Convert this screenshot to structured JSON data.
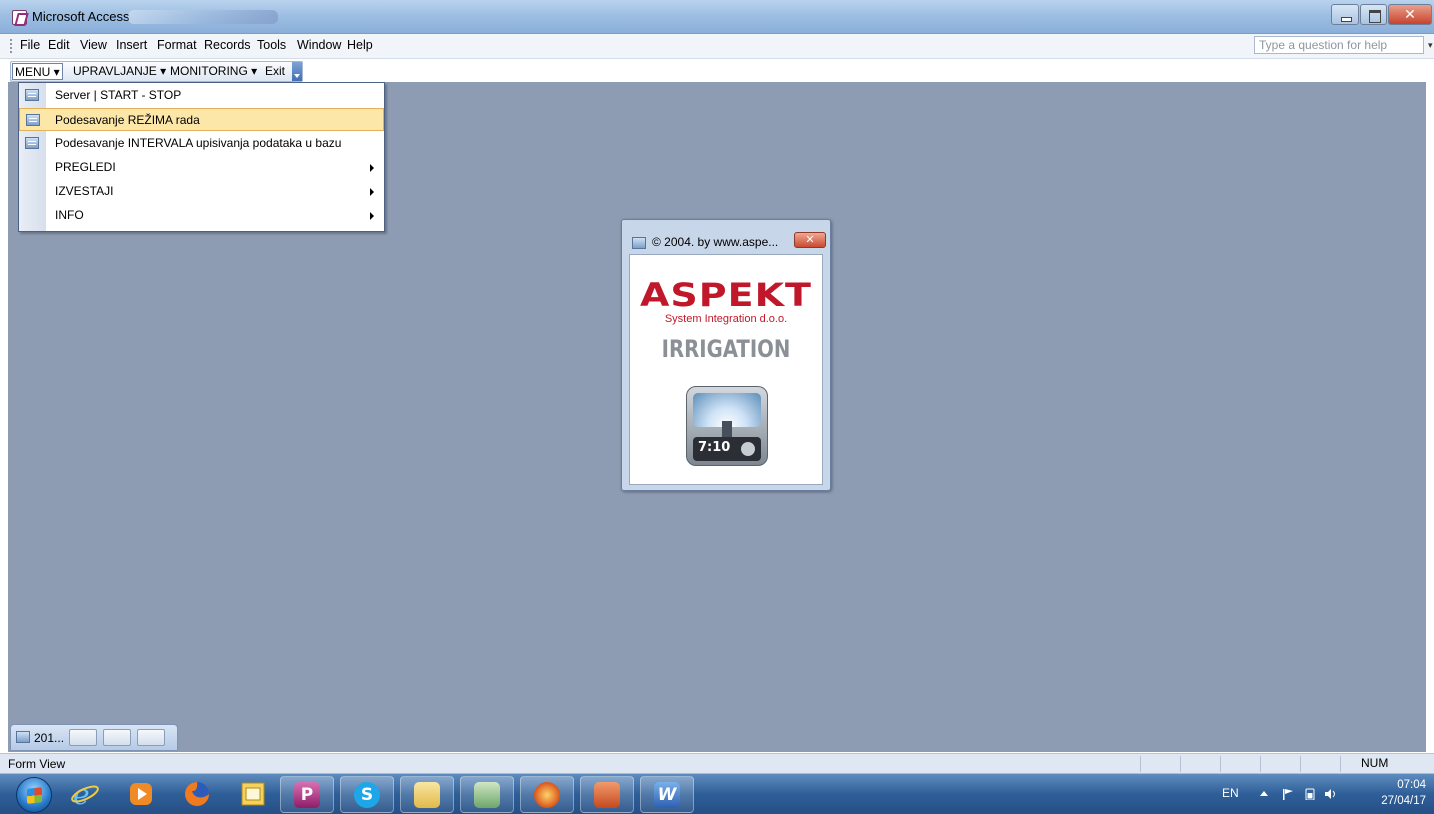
{
  "window": {
    "title": "Microsoft Access",
    "controls": [
      "minimize",
      "maximize",
      "close"
    ]
  },
  "menubar": {
    "items": [
      "File",
      "Edit",
      "View",
      "Insert",
      "Format",
      "Records",
      "Tools",
      "Window",
      "Help"
    ],
    "help_placeholder": "Type a question for help"
  },
  "toolbar": {
    "menu": "MENU",
    "upravljanje": "UPRAVLJANJE",
    "monitoring": "MONITORING",
    "exit": "Exit"
  },
  "dropdown": {
    "items": [
      {
        "label": "Server | START - STOP",
        "has_submenu": false
      },
      {
        "label": "Podesavanje REŽIMA rada",
        "has_submenu": false,
        "highlighted": true
      },
      {
        "label": "Podesavanje INTERVALA upisivanja podataka u bazu",
        "has_submenu": false
      },
      {
        "label": "PREGLEDI",
        "has_submenu": true
      },
      {
        "label": "IZVESTAJI",
        "has_submenu": true
      },
      {
        "label": "INFO",
        "has_submenu": true
      }
    ]
  },
  "splash": {
    "title": "© 2004. by www.aspe...",
    "logo": "ASPEKT",
    "subtitle": "System Integration d.o.o.",
    "product": "IRRIGATION",
    "clock": "7:10"
  },
  "minimized_window": {
    "label": "201..."
  },
  "statusbar": {
    "view": "Form View",
    "num": "NUM"
  },
  "taskbar": {
    "apps": [
      "internet-explorer",
      "media-player",
      "firefox",
      "outlook",
      "access",
      "skype",
      "file-explorer",
      "network-tool",
      "media-app",
      "powerpoint",
      "word"
    ],
    "language": "EN",
    "time": "07:04",
    "date": "27/04/17"
  },
  "colors": {
    "workspace": "#8e9cb3",
    "menu_highlight": "#fde7a8",
    "logo_red": "#c0182a"
  }
}
